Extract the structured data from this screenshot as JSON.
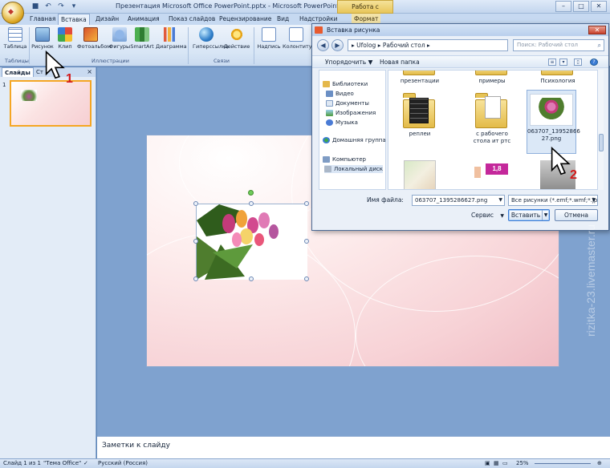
{
  "window": {
    "title": "Презентация Microsoft Office PowerPoint.pptx - Microsoft PowerPoint",
    "context_tab_group": "Работа с рисунками",
    "office_button_label": "",
    "minimize": "–",
    "maximize": "□",
    "close": "✕"
  },
  "ribbon_tabs": [
    "Главная",
    "Вставка",
    "Дизайн",
    "Анимация",
    "Показ слайдов",
    "Рецензирование",
    "Вид",
    "Надстройки",
    "Формат"
  ],
  "ribbon": {
    "buttons": {
      "table": "Таблица",
      "picture": "Рисунок",
      "clip": "Клип",
      "photo_album": "Фотоальбом",
      "shapes": "Фигуры",
      "smartart": "SmartArt",
      "chart": "Диаграмма",
      "hyperlink": "Гиперссылка",
      "action": "Действие",
      "textbox": "Надпись",
      "header_footer": "Колонтитул"
    },
    "groups": {
      "tables": "Таблицы",
      "illustrations": "Иллюстрации",
      "links": "Связи"
    }
  },
  "left_panel": {
    "tab_slides": "Слайды",
    "tab_structure": "Ст",
    "close": "×",
    "slide_number": "1"
  },
  "notes": {
    "placeholder": "Заметки к слайду"
  },
  "status_bar": {
    "slide_info": "Слайд 1 из 1",
    "theme": "\"Тема Office\"",
    "language": "Русский (Россия)",
    "zoom": "25%"
  },
  "dialog": {
    "title": "Вставка рисунка",
    "close": "✕",
    "back": "◀",
    "forward": "▶",
    "address": [
      "Ufolog",
      "Рабочий стол"
    ],
    "search_placeholder": "Поиск: Рабочий стол",
    "toolbar": {
      "organize": "Упорядочить ▼",
      "new_folder": "Новая папка",
      "help": "?"
    },
    "sidebar": [
      {
        "label": "Библиотеки",
        "icon": "libraries-icon"
      },
      {
        "label": "Видео",
        "icon": "video-icon"
      },
      {
        "label": "Документы",
        "icon": "documents-icon"
      },
      {
        "label": "Изображения",
        "icon": "images-icon"
      },
      {
        "label": "Музыка",
        "icon": "music-icon"
      },
      {
        "label": "Домашняя группа",
        "icon": "homegroup-icon"
      },
      {
        "label": "Компьютер",
        "icon": "computer-icon"
      },
      {
        "label": "Локальный диск",
        "icon": "disk-icon"
      }
    ],
    "files": [
      {
        "name": "презентации",
        "kind": "folder"
      },
      {
        "name": "примеры",
        "kind": "folder"
      },
      {
        "name": "Психология",
        "kind": "folder"
      },
      {
        "name": "реплеи",
        "kind": "folder-film"
      },
      {
        "name": "с рабочего стола ит ртс",
        "kind": "folder-docs"
      },
      {
        "name": "063707_13952866 27.png",
        "kind": "image-tulips",
        "selected": true
      },
      {
        "name": "",
        "kind": "image-map"
      },
      {
        "name": "",
        "kind": "image-badge"
      },
      {
        "name": "",
        "kind": "image-gray"
      }
    ],
    "badge_text": "1,8",
    "filename_label": "Имя файла:",
    "filename_value": "063707_1395286627.png",
    "filter_value": "Все рисунки (*.emf;*.wmf;*.jpg",
    "service": "Сервис",
    "insert": "Вставить",
    "cancel": "Отмена",
    "dropdown": "▼"
  },
  "markers": {
    "step1": "1",
    "step2": "2"
  },
  "watermark": "rizitka-23.livemaster.ru",
  "colors": {
    "ribbon_bg": "#d7e5f5",
    "accent_selection": "#f5a623",
    "canvas_bg": "#7fa2cf",
    "marker_red": "#d21a1a"
  }
}
